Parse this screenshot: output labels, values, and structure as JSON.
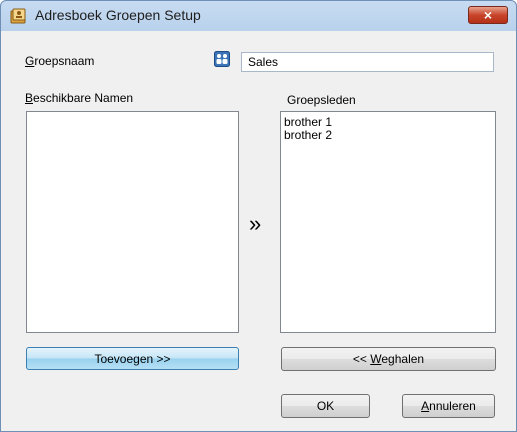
{
  "window": {
    "title": "Adresboek Groepen Setup",
    "close_label": "×"
  },
  "group_name": {
    "label_prefix": "",
    "label_mnemonic": "G",
    "label_rest": "roepsnaam",
    "value": "Sales"
  },
  "available_names": {
    "label_mnemonic": "B",
    "label_rest": "eschikbare Namen",
    "items": []
  },
  "group_members": {
    "label": "Groepsleden",
    "items": [
      "brother 1",
      "brother 2"
    ]
  },
  "transfer_glyph": "»",
  "buttons": {
    "add_label": "Toevoegen >>",
    "remove_prefix": "<< ",
    "remove_mnemonic": "W",
    "remove_rest": "eghalen",
    "ok_label": "OK",
    "cancel_mnemonic": "A",
    "cancel_rest": "nnuleren"
  },
  "colors": {
    "title_gradient_top": "#c7dcf2",
    "dialog_background": "#f0f0f0",
    "close_button": "#c8452b",
    "default_button_border": "#3c7fb1"
  },
  "icons": {
    "app": "address-book-icon",
    "group": "group-people-icon"
  }
}
